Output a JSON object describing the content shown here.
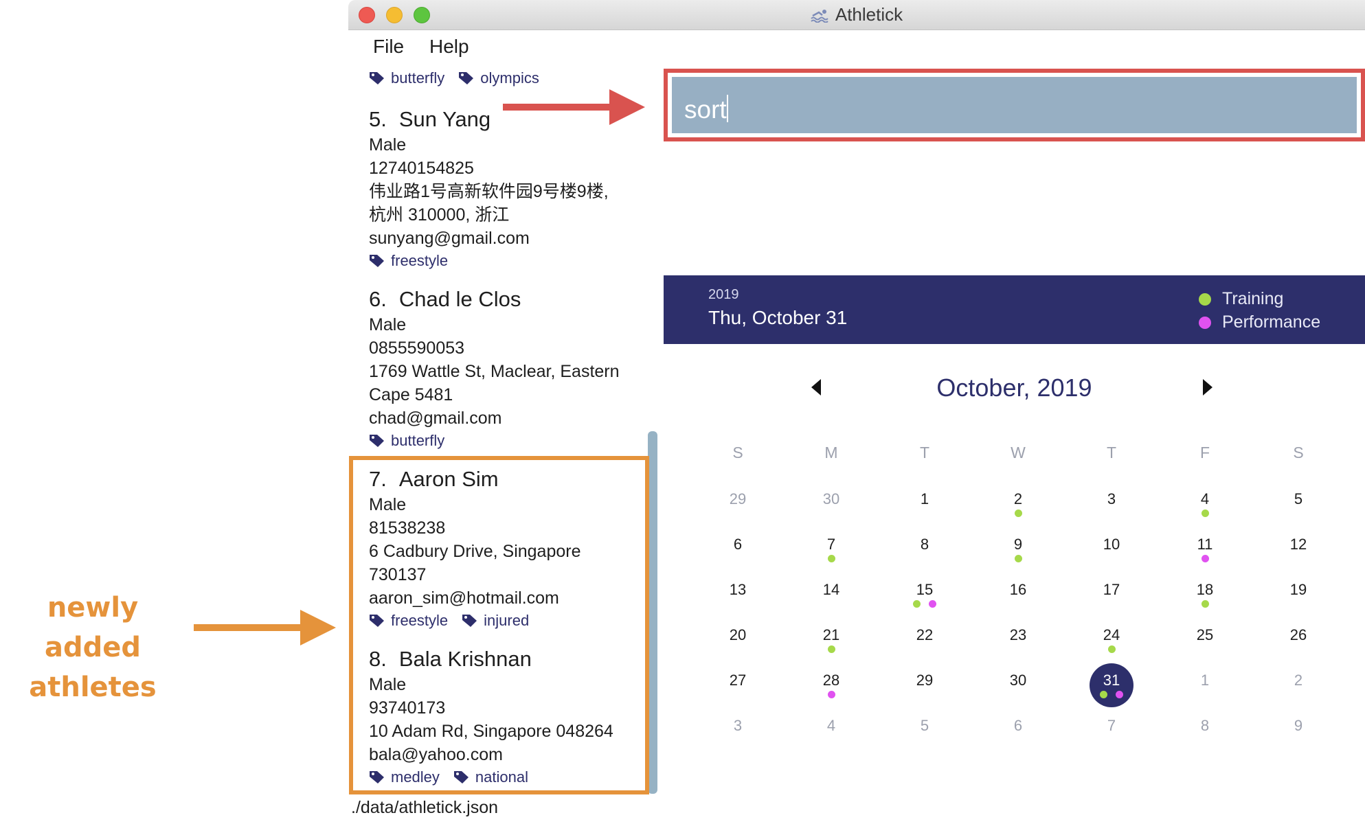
{
  "window": {
    "title": "Athletick"
  },
  "menu": {
    "file": "File",
    "help": "Help"
  },
  "top_tags": [
    "butterfly",
    "olympics"
  ],
  "athletes": [
    {
      "index": "5.",
      "name": "Sun Yang",
      "gender": "Male",
      "phone": "12740154825",
      "address_lines": [
        "伟业路1号高新软件园9号楼9楼,",
        "杭州 310000, 浙江"
      ],
      "email": "sunyang@gmail.com",
      "tags": [
        "freestyle"
      ]
    },
    {
      "index": "6.",
      "name": "Chad le Clos",
      "gender": "Male",
      "phone": "0855590053",
      "address_lines": [
        "1769 Wattle St, Maclear, Eastern",
        "Cape 5481"
      ],
      "email": "chad@gmail.com",
      "tags": [
        "butterfly"
      ]
    },
    {
      "index": "7.",
      "name": "Aaron Sim",
      "gender": "Male",
      "phone": "81538238",
      "address_lines": [
        "6 Cadbury Drive, Singapore",
        "730137"
      ],
      "email": "aaron_sim@hotmail.com",
      "tags": [
        "freestyle",
        "injured"
      ]
    },
    {
      "index": "8.",
      "name": "Bala Krishnan",
      "gender": "Male",
      "phone": "93740173",
      "address_lines": [
        "10 Adam Rd, Singapore 048264"
      ],
      "email": "bala@yahoo.com",
      "tags": [
        "medley",
        "national"
      ]
    }
  ],
  "status": {
    "path": "./data/athletick.json"
  },
  "command": {
    "value": "sort"
  },
  "calendar": {
    "year": "2019",
    "selected_date": "Thu, October 31",
    "month_label": "October, 2019",
    "legend": {
      "training": "Training",
      "performance": "Performance"
    },
    "colors": {
      "training": "#a6d94a",
      "performance": "#e052f0",
      "header": "#2d2f6b"
    },
    "weekdays": [
      "S",
      "M",
      "T",
      "W",
      "T",
      "F",
      "S"
    ],
    "weeks": [
      [
        {
          "d": "29",
          "m": true
        },
        {
          "d": "30",
          "m": true
        },
        {
          "d": "1"
        },
        {
          "d": "2",
          "t": true
        },
        {
          "d": "3"
        },
        {
          "d": "4",
          "t": true
        },
        {
          "d": "5"
        }
      ],
      [
        {
          "d": "6"
        },
        {
          "d": "7",
          "t": true
        },
        {
          "d": "8"
        },
        {
          "d": "9",
          "t": true
        },
        {
          "d": "10"
        },
        {
          "d": "11",
          "p": true
        },
        {
          "d": "12"
        }
      ],
      [
        {
          "d": "13"
        },
        {
          "d": "14"
        },
        {
          "d": "15",
          "t": true,
          "p": true
        },
        {
          "d": "16"
        },
        {
          "d": "17"
        },
        {
          "d": "18",
          "t": true
        },
        {
          "d": "19"
        }
      ],
      [
        {
          "d": "20"
        },
        {
          "d": "21",
          "t": true
        },
        {
          "d": "22"
        },
        {
          "d": "23"
        },
        {
          "d": "24",
          "t": true
        },
        {
          "d": "25"
        },
        {
          "d": "26"
        }
      ],
      [
        {
          "d": "27"
        },
        {
          "d": "28",
          "p": true
        },
        {
          "d": "29"
        },
        {
          "d": "30"
        },
        {
          "d": "31",
          "t": true,
          "p": true,
          "sel": true
        },
        {
          "d": "1",
          "m": true
        },
        {
          "d": "2",
          "m": true
        }
      ],
      [
        {
          "d": "3",
          "m": true
        },
        {
          "d": "4",
          "m": true
        },
        {
          "d": "5",
          "m": true
        },
        {
          "d": "6",
          "m": true
        },
        {
          "d": "7",
          "m": true
        },
        {
          "d": "8",
          "m": true
        },
        {
          "d": "9",
          "m": true
        }
      ]
    ]
  },
  "annotation": {
    "label_lines": [
      "newly added",
      "athletes"
    ]
  }
}
